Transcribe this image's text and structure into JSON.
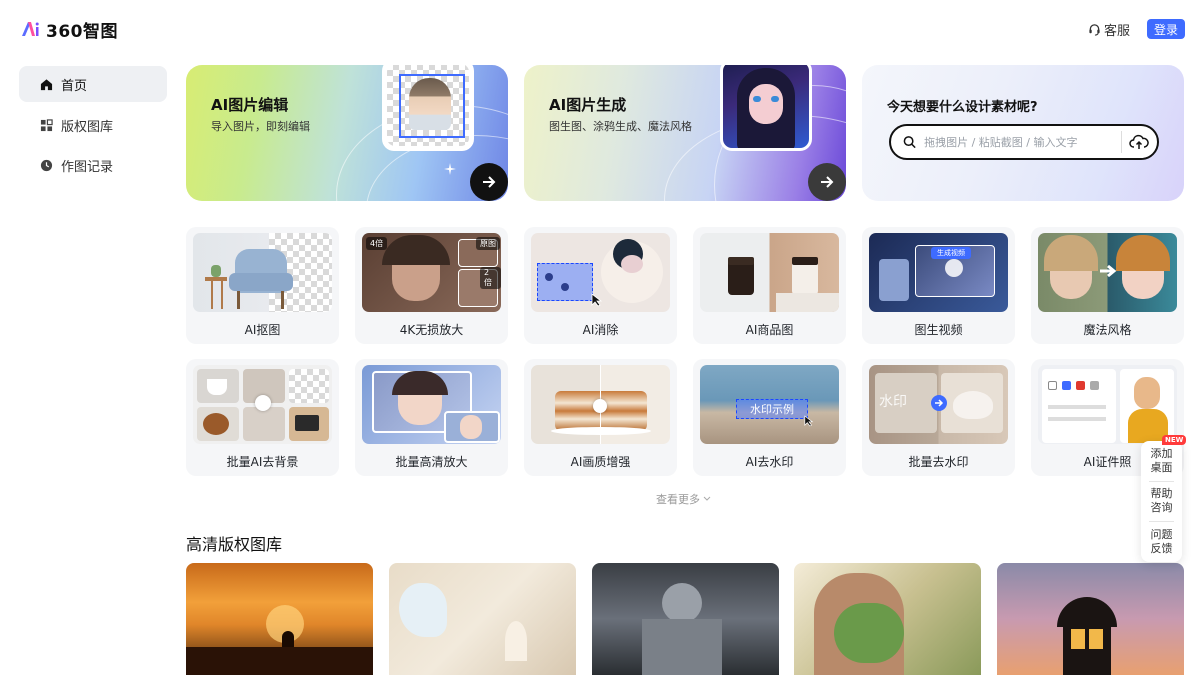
{
  "header": {
    "logo_text": "360智图",
    "customer_service": "客服",
    "login": "登录"
  },
  "sidebar": {
    "items": [
      {
        "label": "首页",
        "icon": "home-icon",
        "active": true
      },
      {
        "label": "版权图库",
        "icon": "grid-icon",
        "active": false
      },
      {
        "label": "作图记录",
        "icon": "clock-icon",
        "active": false
      }
    ]
  },
  "hero": {
    "edit": {
      "title": "AI图片编辑",
      "subtitle": "导入图片，即刻编辑"
    },
    "generate": {
      "title": "AI图片生成",
      "subtitle": "图生图、涂鸦生成、魔法风格"
    },
    "search": {
      "title": "今天想要什么设计素材呢?",
      "placeholder": "拖拽图片 / 粘贴截图 / 输入文字"
    }
  },
  "tools": [
    {
      "label": "AI抠图"
    },
    {
      "label": "4K无损放大",
      "tags": [
        "4倍",
        "原图",
        "2倍"
      ]
    },
    {
      "label": "AI消除"
    },
    {
      "label": "AI商品图"
    },
    {
      "label": "图生视频",
      "tags": [
        "生成视频"
      ]
    },
    {
      "label": "魔法风格"
    },
    {
      "label": "批量AI去背景"
    },
    {
      "label": "批量高清放大"
    },
    {
      "label": "AI画质增强"
    },
    {
      "label": "AI去水印",
      "watermark": "水印示例"
    },
    {
      "label": "批量去水印",
      "watermark": "水印"
    },
    {
      "label": "AI证件照"
    }
  ],
  "more": "查看更多",
  "gallery": {
    "title": "高清版权图库"
  },
  "float_panel": {
    "badge": "NEW",
    "items": [
      "添加\n桌面",
      "帮助\n咨询",
      "问题\n反馈"
    ],
    "items_l1": [
      "添加",
      "帮助",
      "问题"
    ],
    "items_l2": [
      "桌面",
      "咨询",
      "反馈"
    ]
  },
  "colors": {
    "accent": "#3e6bff",
    "new_badge": "#ff3b3b"
  }
}
